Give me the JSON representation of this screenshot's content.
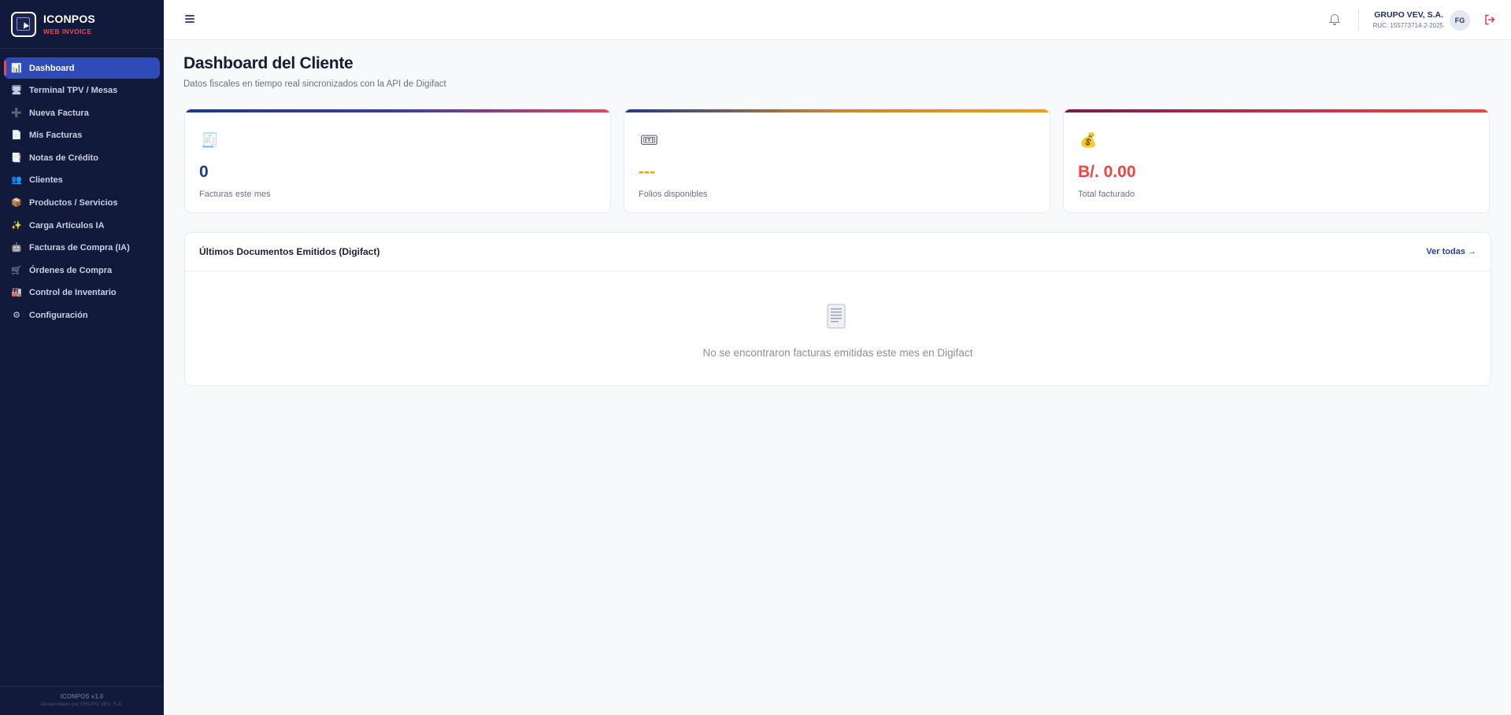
{
  "brand": {
    "title": "ICONPOS",
    "subtitle": "WEB INVOICE"
  },
  "sidebar": {
    "items": [
      {
        "label": "Dashboard",
        "icon": "📊"
      },
      {
        "label": "Terminal TPV / Mesas",
        "icon": "🖥"
      },
      {
        "label": "Nueva Factura",
        "icon": "➕"
      },
      {
        "label": "Mis Facturas",
        "icon": "📄"
      },
      {
        "label": "Notas de Crédito",
        "icon": "📑"
      },
      {
        "label": "Clientes",
        "icon": "👥"
      },
      {
        "label": "Productos / Servicios",
        "icon": "📦"
      },
      {
        "label": "Carga Artículos IA",
        "icon": "✨"
      },
      {
        "label": "Facturas de Compra (IA)",
        "icon": "🤖"
      },
      {
        "label": "Órdenes de Compra",
        "icon": "🛒"
      },
      {
        "label": "Control de Inventario",
        "icon": "🏭"
      },
      {
        "label": "Configuración",
        "icon": "⚙"
      }
    ],
    "footer_version": "ICONPOS v1.0",
    "footer_by": "Desarrollado por GRUPO VEV, S.A."
  },
  "header": {
    "company": "GRUPO VEV, S.A.",
    "ruc": "RUC: 155773714-2-2025",
    "avatar": "FG"
  },
  "main": {
    "title": "Dashboard del Cliente",
    "subtitle": "Datos fiscales en tiempo real sincronizados con la API de Digifact"
  },
  "cards": [
    {
      "icon": "🧾",
      "value": "0",
      "label": "Facturas este mes",
      "color": "#1e3a8a"
    },
    {
      "icon": "🎟",
      "value": "---",
      "label": "Folios disponibles",
      "color": "#f59e0b"
    },
    {
      "icon": "💰",
      "value": "B/. 0.00",
      "label": "Total facturado",
      "color": "#ef4444"
    }
  ],
  "docs": {
    "title": "Últimos Documentos Emitidos (Digifact)",
    "link": "Ver todas →",
    "empty": "No se encontraron facturas emitidas este mes en Digifact"
  },
  "colors": {
    "sidebar_bg": "#111a3b",
    "active_bg": "#2f4bb8",
    "accent_red": "#ef4458"
  }
}
